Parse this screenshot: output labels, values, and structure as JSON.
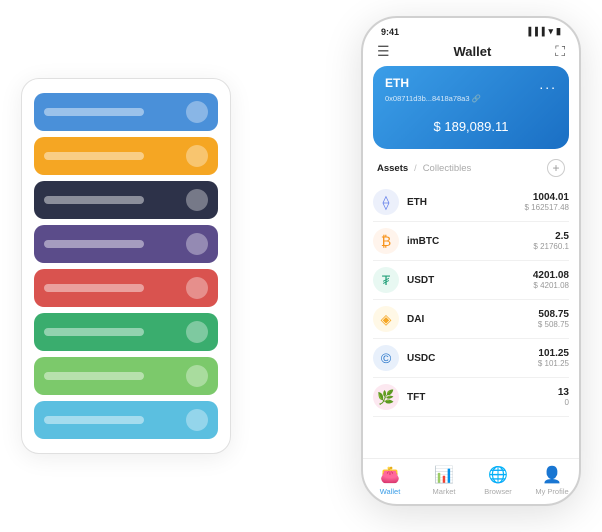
{
  "scene": {
    "cardStack": {
      "cards": [
        {
          "color": "card-blue",
          "hasIcon": true
        },
        {
          "color": "card-orange",
          "hasIcon": true
        },
        {
          "color": "card-dark",
          "hasIcon": true
        },
        {
          "color": "card-purple",
          "hasIcon": true
        },
        {
          "color": "card-red",
          "hasIcon": true
        },
        {
          "color": "card-green",
          "hasIcon": true
        },
        {
          "color": "card-light-green",
          "hasIcon": true
        },
        {
          "color": "card-sky",
          "hasIcon": true
        }
      ]
    },
    "phone": {
      "statusBar": {
        "time": "9:41",
        "signal": "●●●●",
        "wifi": "WiFi",
        "battery": "🔋"
      },
      "nav": {
        "menuIcon": "☰",
        "title": "Wallet",
        "expandIcon": "⛶"
      },
      "walletCard": {
        "coinName": "ETH",
        "address": "0x08711d3b...8418a78a3 🔗",
        "dotsLabel": "...",
        "balancePrefix": "$ ",
        "balance": "189,089.11"
      },
      "assetsHeader": {
        "activeTab": "Assets",
        "separator": "/",
        "inactiveTab": "Collectibles",
        "addIcon": "+"
      },
      "tokens": [
        {
          "iconText": "⟠",
          "iconClass": "icon-eth",
          "name": "ETH",
          "amount": "1004.01",
          "usd": "$ 162517.48"
        },
        {
          "iconText": "₿",
          "iconClass": "icon-imbtc",
          "name": "imBTC",
          "amount": "2.5",
          "usd": "$ 21760.1"
        },
        {
          "iconText": "₮",
          "iconClass": "icon-usdt",
          "name": "USDT",
          "amount": "4201.08",
          "usd": "$ 4201.08"
        },
        {
          "iconText": "◈",
          "iconClass": "icon-dai",
          "name": "DAI",
          "amount": "508.75",
          "usd": "$ 508.75"
        },
        {
          "iconText": "©",
          "iconClass": "icon-usdc",
          "name": "USDC",
          "amount": "101.25",
          "usd": "$ 101.25"
        },
        {
          "iconText": "🌿",
          "iconClass": "icon-tft",
          "name": "TFT",
          "amount": "13",
          "usd": "0"
        }
      ],
      "bottomNav": [
        {
          "icon": "👛",
          "label": "Wallet",
          "active": true
        },
        {
          "icon": "📊",
          "label": "Market",
          "active": false
        },
        {
          "icon": "🌐",
          "label": "Browser",
          "active": false
        },
        {
          "icon": "👤",
          "label": "My Profile",
          "active": false
        }
      ]
    }
  }
}
